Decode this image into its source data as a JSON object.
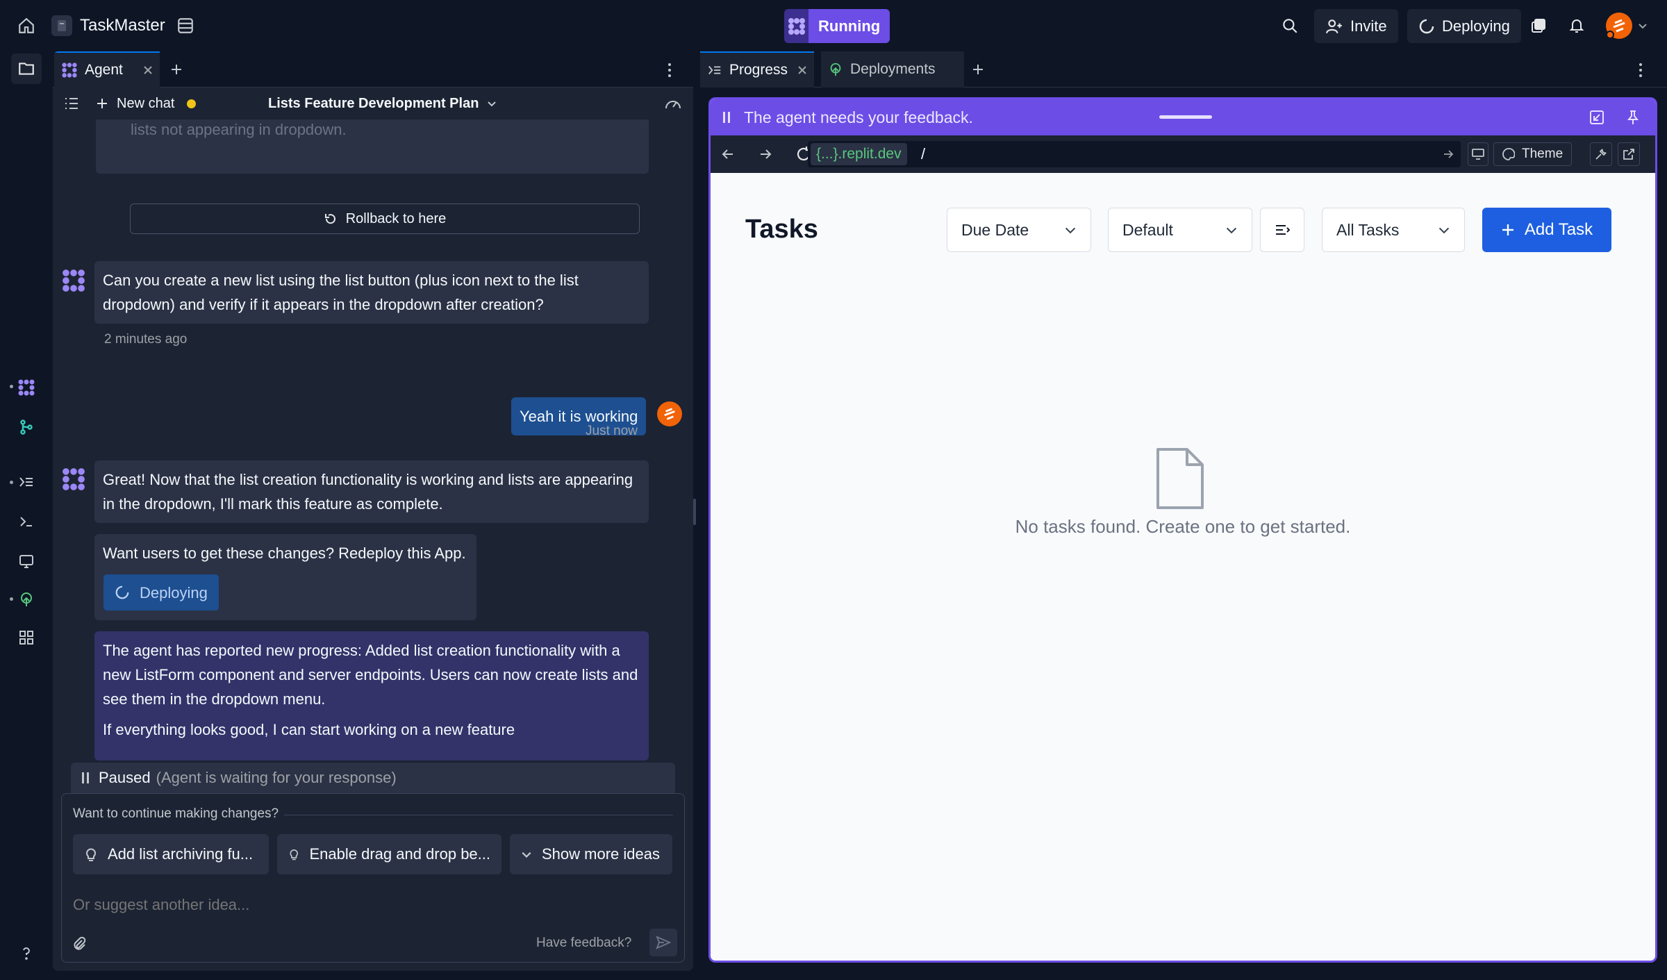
{
  "topbar": {
    "app_name": "TaskMaster",
    "run_label": "Running",
    "invite_label": "Invite",
    "deploying_label": "Deploying"
  },
  "agent_panel": {
    "tab_label": "Agent",
    "new_chat_label": "New chat",
    "plan_title": "Lists Feature Development Plan",
    "messages": {
      "faded_text": "lists not appearing in dropdown.",
      "rollback_label": "Rollback to here",
      "agent_question": "Can you create a new list using the list button (plus icon next to the list dropdown) and verify if it appears in the dropdown after creation?",
      "agent_question_time": "2 minutes ago",
      "user_reply": "Yeah it is working",
      "user_reply_time": "Just now",
      "agent_reply": "Great! Now that the list creation functionality is working and lists are appearing in the dropdown, I'll mark this feature as complete.",
      "redeploy_prompt": "Want users to get these changes? Redeploy this App.",
      "deploying_label": "Deploying",
      "progress_report": "The agent has reported new progress: Added list creation functionality with a new ListForm component and server endpoints. Users can now create lists and see them in the dropdown menu.",
      "progress_followup": "If everything looks good, I can start working on a new feature"
    },
    "paused": {
      "label": "Paused",
      "detail": "(Agent is waiting for your response)"
    },
    "composer": {
      "heading": "Want to continue making changes?",
      "ideas": [
        "Add list archiving fu...",
        "Enable drag and drop be...",
        "Show more ideas"
      ],
      "placeholder": "Or suggest another idea...",
      "feedback_label": "Have feedback?"
    }
  },
  "right_panel": {
    "tabs": [
      "Progress",
      "Deployments"
    ],
    "feedback_text": "The agent needs your feedback.",
    "url_domain": "{...}.replit.dev",
    "url_path": "/",
    "theme_label": "Theme",
    "app": {
      "title": "Tasks",
      "sort_select": "Due Date",
      "order_select": "Default",
      "filter_select": "All Tasks",
      "add_task_label": "Add Task",
      "empty_message": "No tasks found. Create one to get started."
    }
  },
  "colors": {
    "background": "#0e1525",
    "surface": "#1c2333",
    "accent_purple": "#6c4de6",
    "accent_blue": "#1d5fe0"
  }
}
